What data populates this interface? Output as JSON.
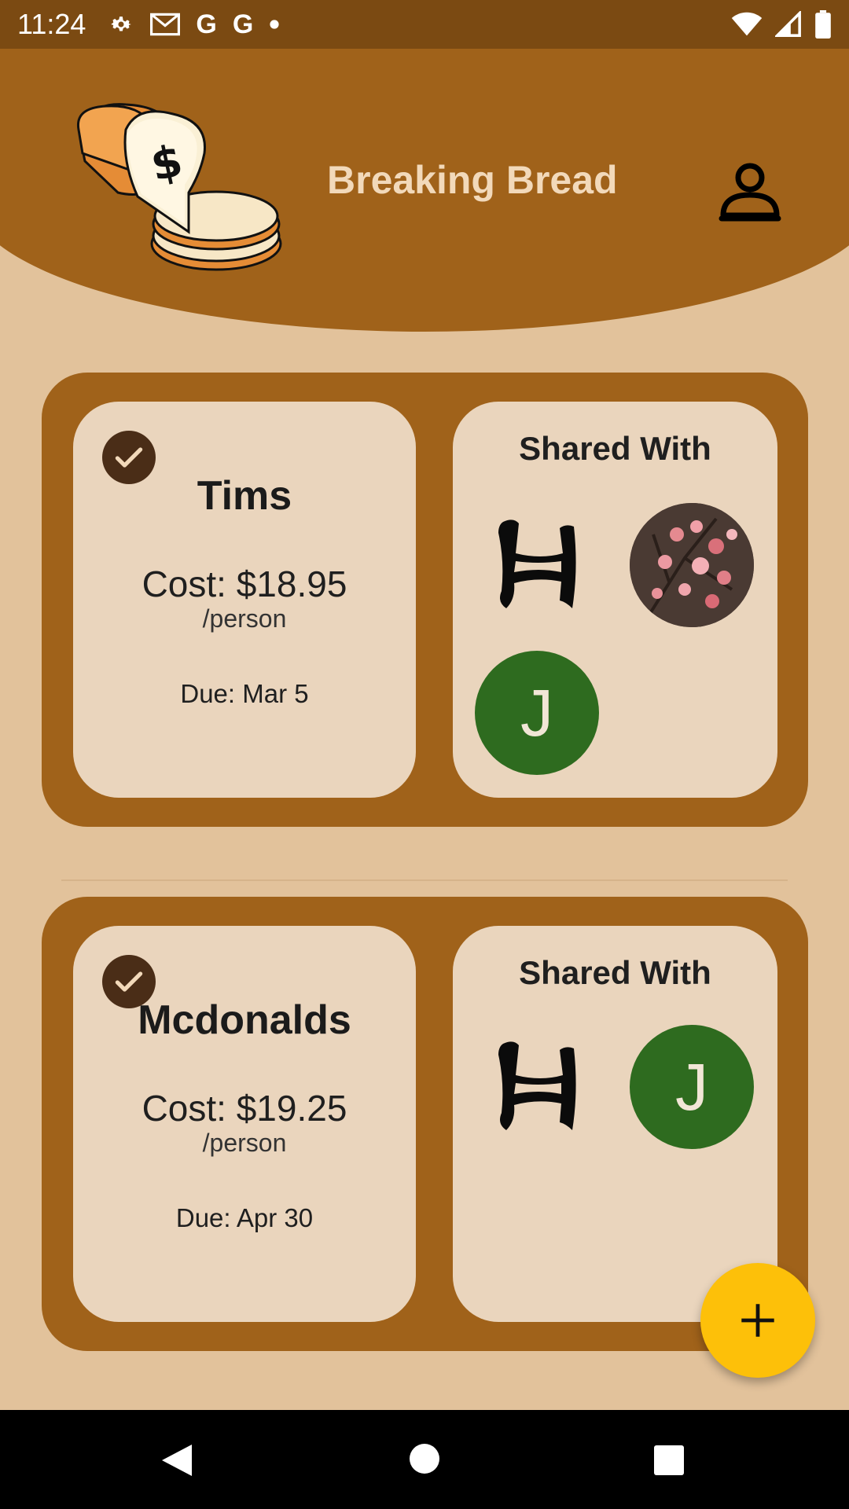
{
  "status_bar": {
    "time": "11:24",
    "left_icons": [
      "gear-icon",
      "gmail-icon",
      "google-icon",
      "google-icon",
      "dot-icon"
    ],
    "right_icons": [
      "wifi-icon",
      "signal-icon",
      "battery-icon"
    ]
  },
  "header": {
    "title": "Breaking Bread"
  },
  "bills": [
    {
      "name": "Tims",
      "cost": "Cost: $18.95",
      "per": "/person",
      "due": "Due: Mar 5",
      "shared_title": "Shared With",
      "avatars": [
        {
          "type": "glyph",
          "label": "H"
        },
        {
          "type": "photo",
          "label": "blossom photo"
        },
        {
          "type": "letter",
          "label": "J"
        }
      ]
    },
    {
      "name": "Mcdonalds",
      "cost": "Cost: $19.25",
      "per": "/person",
      "due": "Due: Apr 30",
      "shared_title": "Shared With",
      "avatars": [
        {
          "type": "glyph",
          "label": "H"
        },
        {
          "type": "letter",
          "label": "J"
        }
      ]
    }
  ],
  "fab": {
    "icon": "plus-icon"
  },
  "colors": {
    "header": "#A0621A",
    "status_bar": "#7B4A12",
    "background": "#E2C29B",
    "card_inner": "#EAD5BD",
    "avatar_green": "#2E6B1F",
    "fab": "#FDC009"
  }
}
